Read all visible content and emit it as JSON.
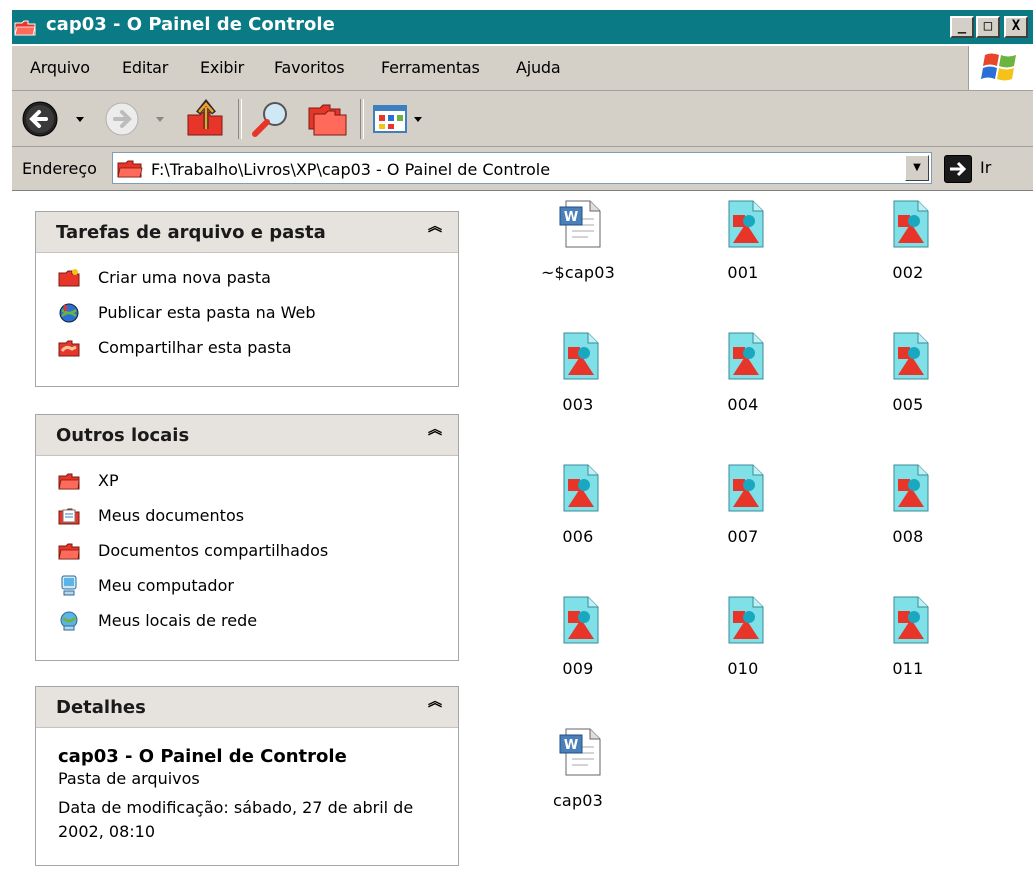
{
  "window": {
    "title": "cap03 - O Painel de Controle",
    "buttons": {
      "minimize": "_",
      "maximize": "□",
      "close": "X"
    }
  },
  "menu": [
    "Arquivo",
    "Editar",
    "Exibir",
    "Favoritos",
    "Ferramentas",
    "Ajuda"
  ],
  "address": {
    "label": "Endereço",
    "value": "F:\\Trabalho\\Livros\\XP\\cap03 - O Painel de Controle",
    "go_label": "Ir"
  },
  "panels": {
    "tasks": {
      "title": "Tarefas de arquivo e pasta",
      "items": [
        {
          "label": "Criar uma nova pasta",
          "icon": "new-folder-icon"
        },
        {
          "label": "Publicar esta pasta na Web",
          "icon": "publish-web-icon"
        },
        {
          "label": "Compartilhar esta pasta",
          "icon": "share-folder-icon"
        }
      ]
    },
    "places": {
      "title": "Outros locais",
      "items": [
        {
          "label": "XP",
          "icon": "folder-icon"
        },
        {
          "label": "Meus documentos",
          "icon": "my-documents-icon"
        },
        {
          "label": "Documentos compartilhados",
          "icon": "shared-documents-icon"
        },
        {
          "label": "Meu computador",
          "icon": "my-computer-icon"
        },
        {
          "label": "Meus locais de rede",
          "icon": "network-places-icon"
        }
      ]
    },
    "details": {
      "title": "Detalhes",
      "name": "cap03 - O Painel de Controle",
      "type": "Pasta de arquivos",
      "modified": "Data de modificação: sábado, 27 de abril de 2002, 08:10"
    }
  },
  "files": [
    {
      "name": "~$cap03",
      "type": "word"
    },
    {
      "name": "001",
      "type": "image"
    },
    {
      "name": "002",
      "type": "image"
    },
    {
      "name": "003",
      "type": "image"
    },
    {
      "name": "004",
      "type": "image"
    },
    {
      "name": "005",
      "type": "image"
    },
    {
      "name": "006",
      "type": "image"
    },
    {
      "name": "007",
      "type": "image"
    },
    {
      "name": "008",
      "type": "image"
    },
    {
      "name": "009",
      "type": "image"
    },
    {
      "name": "010",
      "type": "image"
    },
    {
      "name": "011",
      "type": "image"
    },
    {
      "name": "cap03",
      "type": "word"
    }
  ]
}
